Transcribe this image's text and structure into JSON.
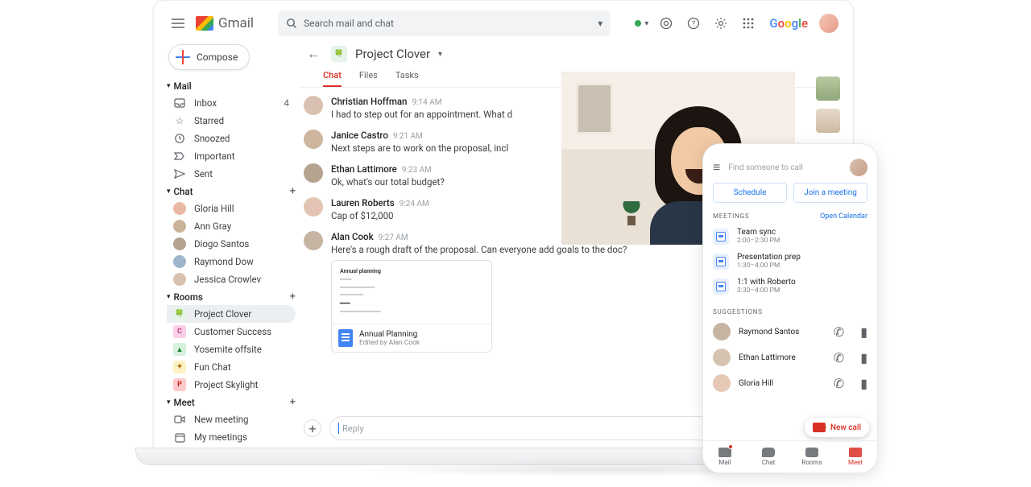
{
  "header": {
    "app_name": "Gmail",
    "search_placeholder": "Search mail and chat",
    "google_label": "Google"
  },
  "compose_label": "Compose",
  "sections": {
    "mail": {
      "title": "Mail",
      "items": [
        {
          "label": "Inbox",
          "count": "4"
        },
        {
          "label": "Starred"
        },
        {
          "label": "Snoozed"
        },
        {
          "label": "Important"
        },
        {
          "label": "Sent"
        }
      ]
    },
    "chat": {
      "title": "Chat",
      "items": [
        {
          "label": "Gloria Hill"
        },
        {
          "label": "Ann Gray"
        },
        {
          "label": "Diogo Santos"
        },
        {
          "label": "Raymond Dow"
        },
        {
          "label": "Jessica Crowlev"
        }
      ]
    },
    "rooms": {
      "title": "Rooms",
      "items": [
        {
          "label": "Project Clover",
          "badge": "🍀",
          "color": "#e6f4ea",
          "selected": true
        },
        {
          "label": "Customer Success",
          "badge": "C",
          "color": "#fbcfe8"
        },
        {
          "label": "Yosemite offsite",
          "badge": "▲",
          "color": "#d7f0dc"
        },
        {
          "label": "Fun Chat",
          "badge": "✦",
          "color": "#fef3c7"
        },
        {
          "label": "Project Skylight",
          "badge": "P",
          "color": "#fecaca"
        }
      ]
    },
    "meet": {
      "title": "Meet",
      "items": [
        {
          "label": "New meeting"
        },
        {
          "label": "My meetings"
        }
      ]
    }
  },
  "thread": {
    "title": "Project Clover",
    "tabs": [
      "Chat",
      "Files",
      "Tasks"
    ],
    "active_tab": 0,
    "messages": [
      {
        "author": "Christian Hoffman",
        "time": "9:14 AM",
        "text": "I had to step out for an appointment. What d"
      },
      {
        "author": "Janice Castro",
        "time": "9:21 AM",
        "text": "Next steps are to work on the proposal, incl"
      },
      {
        "author": "Ethan Lattimore",
        "time": "9:23 AM",
        "text": "Ok, what's our total budget?"
      },
      {
        "author": "Lauren Roberts",
        "time": "9:24 AM",
        "text": "Cap of $12,000"
      },
      {
        "author": "Alan Cook",
        "time": "9:27 AM",
        "text": "Here's a rough draft of the proposal. Can everyone add goals to the doc?"
      }
    ],
    "doc": {
      "preview_title": "Annual planning",
      "title": "Annual Planning",
      "subtitle": "Edited by Alan Cook"
    },
    "reply_placeholder": "Reply"
  },
  "phone": {
    "search_placeholder": "Find someone to call",
    "schedule_label": "Schedule",
    "join_label": "Join a meeting",
    "meetings_label": "MEETINGS",
    "open_calendar": "Open Calendar",
    "meetings": [
      {
        "title": "Team sync",
        "time": "2:00–2:30 PM"
      },
      {
        "title": "Presentation prep",
        "time": "1:30–4:00 PM"
      },
      {
        "title": "1:1 with Roberto",
        "time": "3:30–4:00 PM"
      }
    ],
    "suggestions_label": "SUGGESTIONS",
    "suggestions": [
      {
        "name": "Raymond Santos"
      },
      {
        "name": "Ethan Lattimore"
      },
      {
        "name": "Gloria Hill"
      }
    ],
    "fab_label": "New call",
    "tabs": [
      "Mail",
      "Chat",
      "Rooms",
      "Meet"
    ]
  }
}
